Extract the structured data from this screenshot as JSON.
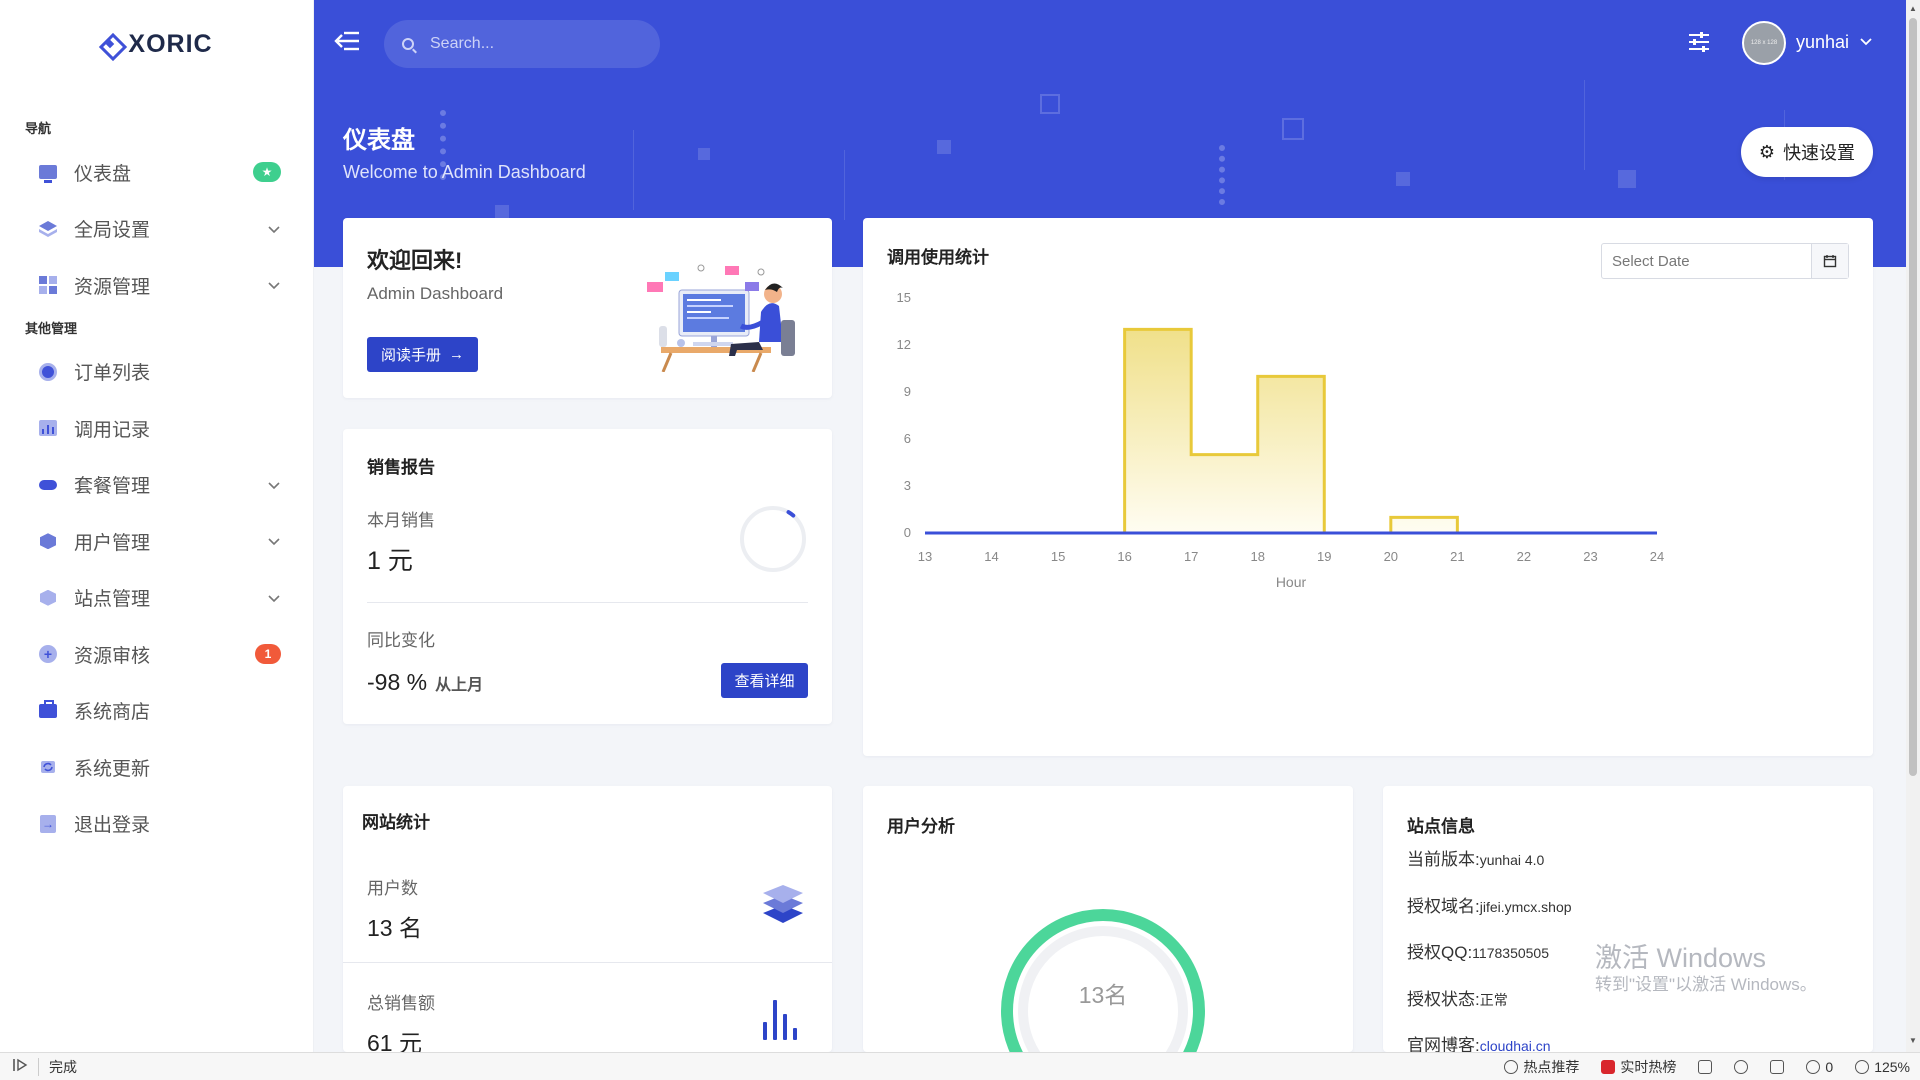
{
  "app": {
    "brand": "XORIC"
  },
  "sidebar": {
    "section_nav": "导航",
    "section_other": "其他管理",
    "items": [
      {
        "label": "仪表盘",
        "icon": "monitor-icon",
        "badge": "★"
      },
      {
        "label": "全局设置",
        "icon": "layers-icon",
        "chevron": "⌄"
      },
      {
        "label": "资源管理",
        "icon": "grid-icon",
        "chevron": "⌄"
      },
      {
        "label": "订单列表",
        "icon": "circle-icon"
      },
      {
        "label": "调用记录",
        "icon": "chart-icon"
      },
      {
        "label": "套餐管理",
        "icon": "pill-icon",
        "chevron": "⌄"
      },
      {
        "label": "用户管理",
        "icon": "cube-icon",
        "chevron": "⌄"
      },
      {
        "label": "站点管理",
        "icon": "cube-icon",
        "chevron": "⌄"
      },
      {
        "label": "资源审核",
        "icon": "plus-circle-icon",
        "badge": "1"
      },
      {
        "label": "系统商店",
        "icon": "bag-icon"
      },
      {
        "label": "系统更新",
        "icon": "refresh-icon"
      },
      {
        "label": "退出登录",
        "icon": "exit-icon"
      }
    ]
  },
  "topbar": {
    "search_placeholder": "Search...",
    "avatar_text": "128 x 128",
    "user_name": "yunhai",
    "user_chevron": "⌄"
  },
  "hero": {
    "title": "仪表盘",
    "subtitle": "Welcome to Admin Dashboard",
    "quick_settings": "快速设置"
  },
  "welcome": {
    "title": "欢迎回来!",
    "subtitle": "Admin Dashboard",
    "button": "阅读手册"
  },
  "sales": {
    "title": "销售报告",
    "month_label": "本月销售",
    "month_value": "1 元",
    "change_label": "同比变化",
    "change_value": "-98 %",
    "change_suffix": "从上月",
    "detail_button": "查看详细",
    "ring_progress": 0.03
  },
  "usage": {
    "title": "调用使用统计",
    "date_placeholder": "Select Date"
  },
  "chart_data": {
    "type": "area",
    "title": "调用使用统计",
    "xlabel": "Hour",
    "ylabel": "",
    "x_ticks": [
      "13",
      "14",
      "15",
      "16",
      "17",
      "18",
      "19",
      "20",
      "21",
      "22",
      "23",
      "24"
    ],
    "y_ticks": [
      "0",
      "3",
      "6",
      "9",
      "12",
      "15"
    ],
    "xlim": [
      13,
      24
    ],
    "ylim": [
      0,
      15
    ],
    "step": true,
    "series": [
      {
        "x": [
          13,
          14,
          15,
          16,
          17,
          18,
          19,
          20,
          21,
          22,
          23
        ],
        "values": [
          0,
          0,
          0,
          13,
          5,
          10,
          0,
          1,
          0,
          0,
          0
        ],
        "color": "#e8c93a"
      }
    ],
    "baseline_color": "#3a4fd8",
    "grid": false
  },
  "site_stats": {
    "title": "网站统计",
    "users_label": "用户数",
    "users_value": "13 名",
    "revenue_label": "总销售额",
    "revenue_value": "61 元"
  },
  "user_analysis": {
    "title": "用户分析",
    "center": "13名",
    "ring_color": "#4cd69a"
  },
  "site_info": {
    "title": "站点信息",
    "rows": [
      {
        "k": "当前版本:",
        "v": "yunhai 4.0"
      },
      {
        "k": "授权域名:",
        "v": "jifei.ymcx.shop"
      },
      {
        "k": "授权QQ:",
        "v": "1178350505"
      },
      {
        "k": "授权状态:",
        "v": "正常"
      },
      {
        "k": "官网博客:",
        "v": "cloudhai.cn"
      }
    ]
  },
  "watermark": {
    "line1": "激活 Windows",
    "line2": "转到\"设置\"以激活 Windows。"
  },
  "statusbar": {
    "status": "完成",
    "hot": "热点推荐",
    "trending": "实时热榜",
    "count": "0",
    "zoom": "125%"
  },
  "colors": {
    "primary": "#3a4fd8",
    "button": "#2d44c8",
    "success": "#3ecf8e",
    "danger": "#f15a3a"
  }
}
